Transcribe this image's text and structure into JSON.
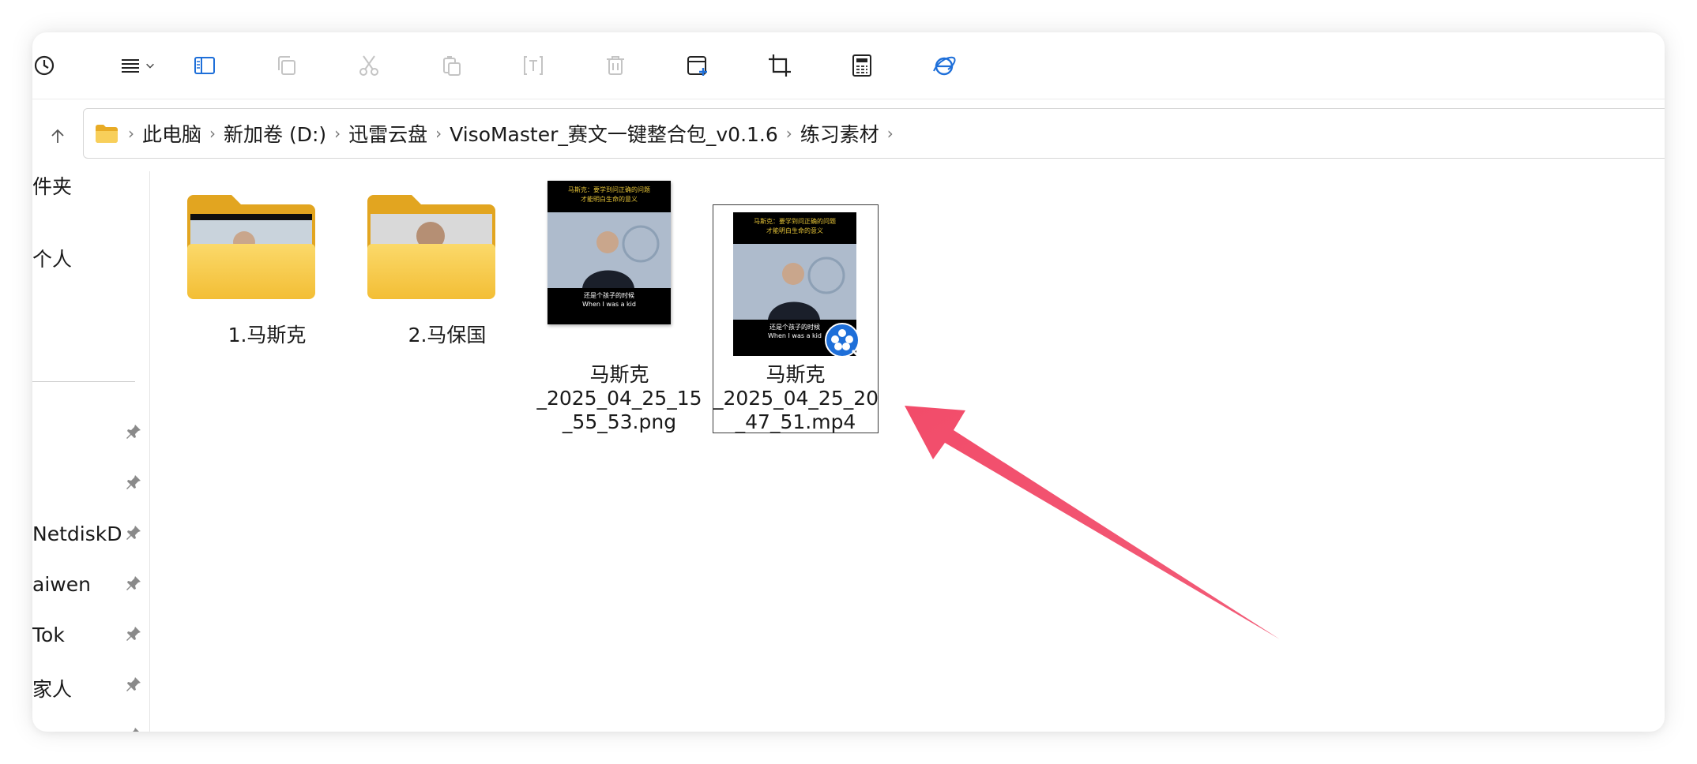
{
  "breadcrumb": [
    "此电脑",
    "新加卷 (D:)",
    "迅雷云盘",
    "VisoMaster_赛文一键整合包_v0.1.6",
    "练习素材"
  ],
  "sidebar": {
    "items": [
      {
        "label": "件夹",
        "pinned": false
      },
      {
        "label": "个人",
        "pinned": false
      },
      {
        "label": "",
        "pinned": true
      },
      {
        "label": "",
        "pinned": true
      },
      {
        "label": "NetdiskDo",
        "pinned": true
      },
      {
        "label": "aiwen",
        "pinned": true
      },
      {
        "label": "Tok",
        "pinned": true
      },
      {
        "label": "家人",
        "pinned": true
      },
      {
        "label": "",
        "pinned": true
      }
    ]
  },
  "files": [
    {
      "name": "1.马斯克",
      "type": "folder"
    },
    {
      "name": "2.马保国",
      "type": "folder"
    },
    {
      "name_lines": [
        "马斯克",
        "_2025_04_25_15",
        "_55_53.png"
      ],
      "type": "image",
      "thumb_caption_top_1": "马斯克：要学到问正确的问题",
      "thumb_caption_top_2": "才能明白生命的意义",
      "thumb_subtitle_cn": "还是个孩子的时候",
      "thumb_subtitle_en": "When I was a kid"
    },
    {
      "name_lines": [
        "马斯克",
        "_2025_04_25_20",
        "_47_51.mp4"
      ],
      "type": "video",
      "selected": true,
      "thumb_caption_top_1": "马斯克：要学到问正确的问题",
      "thumb_caption_top_2": "才能明白生命的意义",
      "thumb_subtitle_cn": "还是个孩子的时候",
      "thumb_subtitle_en": "When I was a kid"
    }
  ],
  "colors": {
    "folder_yellow": "#F5C242",
    "folder_dark": "#E2A520",
    "accent_blue": "#1E6FD9",
    "annotation_arrow": "#F0506E"
  },
  "toolbar_icons": [
    "history-icon",
    "view-menu-icon",
    "details-pane-icon",
    "copy-icon",
    "cut-icon",
    "paste-icon",
    "rename-icon",
    "delete-icon",
    "new-window-icon",
    "crop-icon",
    "calculator-icon",
    "ie-browser-icon"
  ]
}
